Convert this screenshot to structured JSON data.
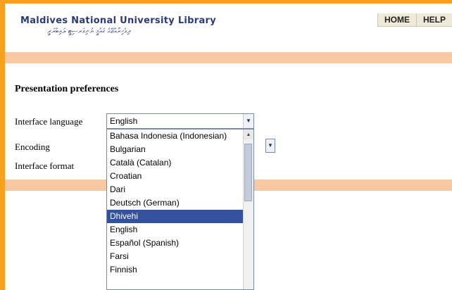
{
  "header": {
    "title": "Maldives National University Library",
    "subtitle": "ދިވެހިރާއްޖޭގެ ޤައުމީ ޔުނިވަރސިޓީ ލައިބްރަރީ"
  },
  "nav": {
    "home": "HOME",
    "help": "HELP"
  },
  "section_title": "Presentation preferences",
  "form": {
    "interface_language_label": "Interface language",
    "encoding_label": "Encoding",
    "interface_format_label": "Interface format",
    "interface_language_value": "English"
  },
  "dropdown": {
    "options": [
      "Bahasa Indonesia (Indonesian)",
      "Bulgarian",
      "Català (Catalan)",
      "Croatian",
      "Dari",
      "Deutsch (German)",
      "Dhivehi",
      "English",
      "Español (Spanish)",
      "Farsi",
      "Finnish"
    ],
    "highlighted": "Dhivehi"
  },
  "icons": {
    "select_arrow": "chevron-down-icon",
    "encoding_arrow": "chevron-down-icon",
    "scroll_up": "chevron-up-icon"
  },
  "colors": {
    "frame": "#f6a21f",
    "band": "#f8c8a2",
    "highlight": "#33519e",
    "title_text": "#2a3a7a"
  }
}
